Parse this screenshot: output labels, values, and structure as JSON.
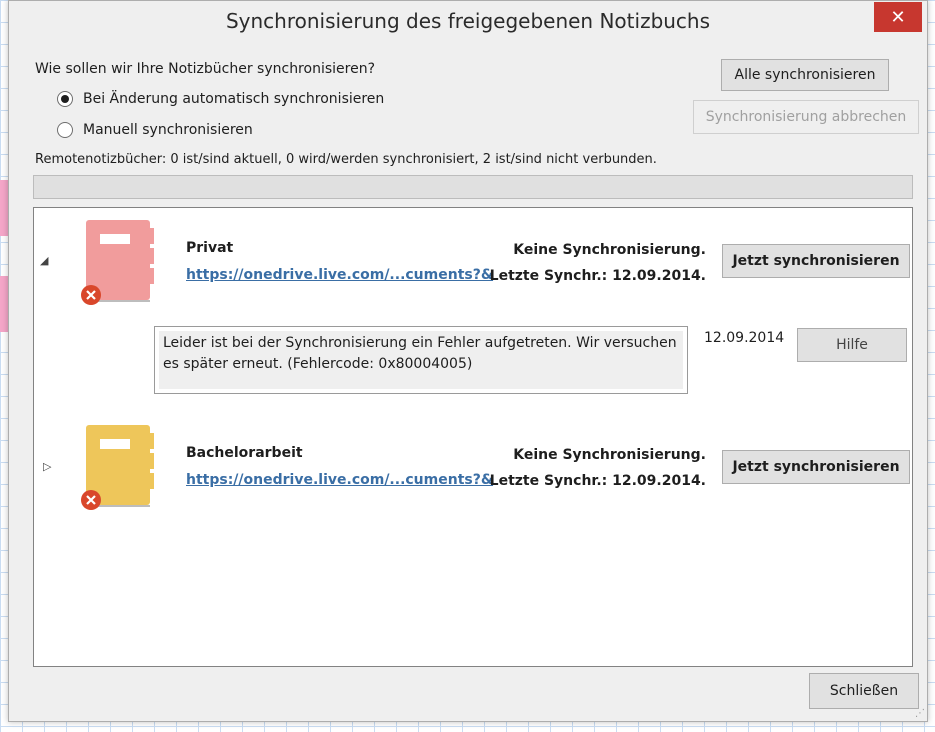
{
  "dialog": {
    "title": "Synchronisierung des freigegebenen Notizbuchs",
    "close_glyph": "✕",
    "question": "Wie sollen wir Ihre Notizbücher synchronisieren?",
    "options": [
      {
        "label": "Bei Änderung automatisch synchronisieren",
        "checked": true
      },
      {
        "label": "Manuell synchronisieren",
        "checked": false
      }
    ],
    "sync_all_button": "Alle synchronisieren",
    "cancel_sync_button": "Synchronisierung abbrechen",
    "remote_status": "Remotenotizbücher: 0 ist/sind aktuell, 0 wird/werden synchronisiert, 2 ist/sind nicht verbunden.",
    "progress": 0,
    "close_button": "Schließen"
  },
  "notebooks": [
    {
      "name": "Privat",
      "link": "https://onedrive.live.com/...cuments?&",
      "status": "Keine Synchronisierung.",
      "last_sync": "Letzte Synchr.: 12.09.2014.",
      "sync_button": "Jetzt synchronisieren",
      "expanded": true,
      "color": "#f19c9c",
      "error": {
        "message": "Leider ist bei der Synchronisierung ein Fehler aufgetreten. Wir versuchen es später erneut. (Fehlercode: 0x80004005)",
        "date": "12.09.2014",
        "help_button": "Hilfe"
      }
    },
    {
      "name": "Bachelorarbeit",
      "link": "https://onedrive.live.com/...cuments?&",
      "status": "Keine Synchronisierung.",
      "last_sync": "Letzte Synchr.: 12.09.2014.",
      "sync_button": "Jetzt synchronisieren",
      "expanded": false,
      "color": "#eec65a"
    }
  ],
  "icons": {
    "expanded": "◢",
    "collapsed": "▷",
    "error": "error-x-icon",
    "notebook": "notebook-icon"
  },
  "colors": {
    "close_red": "#c7372f",
    "link_blue": "#3a6ea5",
    "error_red": "#d9472b"
  }
}
